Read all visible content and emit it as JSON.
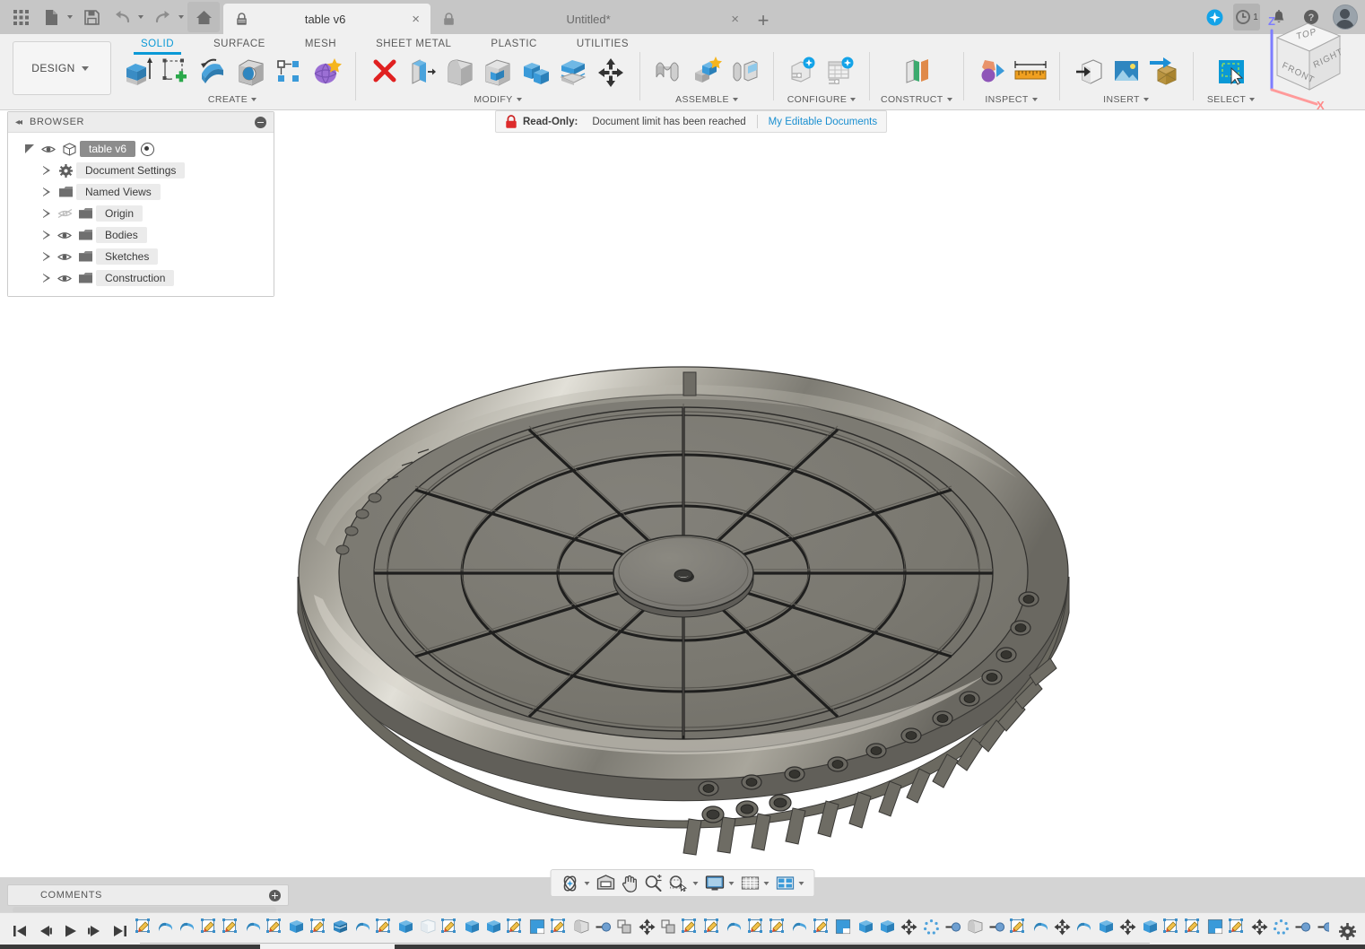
{
  "app": {
    "name": "Autodesk Fusion 360",
    "accent": "#0a99d6",
    "titlebar_bg": "#c6c6c6",
    "ribbon_bg": "#f0f0f0"
  },
  "quick_access": {
    "items": [
      {
        "name": "app-grid-icon",
        "label": "Show Data Panel"
      },
      {
        "name": "file-icon",
        "label": "File",
        "has_caret": true
      },
      {
        "name": "save-icon",
        "label": "Save"
      },
      {
        "name": "undo-icon",
        "label": "Undo",
        "has_caret": true
      },
      {
        "name": "redo-icon",
        "label": "Redo",
        "has_caret": true
      },
      {
        "name": "home-icon",
        "label": "Home"
      }
    ]
  },
  "tabs": [
    {
      "label": "table v6",
      "active": true,
      "locked": true,
      "close": "×"
    },
    {
      "label": "Untitled*",
      "active": false,
      "locked": true,
      "close": "×"
    }
  ],
  "tab_actions": {
    "new_tab": "+",
    "icons": [
      {
        "name": "fusion-sync-icon",
        "label": "Job Status"
      },
      {
        "name": "job-history-icon",
        "label": "1",
        "badge": "1",
        "highlighted": true
      },
      {
        "name": "notification-bell-icon",
        "label": "Notifications"
      },
      {
        "name": "help-icon",
        "label": "Help"
      },
      {
        "name": "account-avatar",
        "label": "Account"
      }
    ]
  },
  "workspace_selector": {
    "label": "DESIGN",
    "caret": "▾"
  },
  "ribbon_tabs": [
    {
      "label": "SOLID",
      "active": true
    },
    {
      "label": "SURFACE",
      "active": false
    },
    {
      "label": "MESH",
      "active": false
    },
    {
      "label": "SHEET METAL",
      "active": false
    },
    {
      "label": "PLASTIC",
      "active": false
    },
    {
      "label": "UTILITIES",
      "active": false
    }
  ],
  "ribbon_panels": [
    {
      "label": "CREATE",
      "has_caret": true,
      "tools": [
        {
          "name": "extrude-icon",
          "label": "Extrude"
        },
        {
          "name": "create-sketch-icon",
          "label": "Create Sketch"
        },
        {
          "name": "revolve-icon",
          "label": "Revolve"
        },
        {
          "name": "hole-icon",
          "label": "Hole"
        },
        {
          "name": "rectangular-pattern-icon",
          "label": "Rectangular Pattern"
        },
        {
          "name": "create-form-icon",
          "label": "Create Form"
        }
      ]
    },
    {
      "label": "MODIFY",
      "has_caret": true,
      "tools": [
        {
          "name": "delete-icon",
          "label": "Delete"
        },
        {
          "name": "press-pull-icon",
          "label": "Press Pull"
        },
        {
          "name": "fillet-icon",
          "label": "Fillet"
        },
        {
          "name": "shell-icon",
          "label": "Shell"
        },
        {
          "name": "combine-icon",
          "label": "Combine"
        },
        {
          "name": "split-face-icon",
          "label": "Split Face"
        },
        {
          "name": "move-copy-icon",
          "label": "Move/Copy"
        }
      ]
    },
    {
      "label": "ASSEMBLE",
      "has_caret": true,
      "tools": [
        {
          "name": "joint-icon",
          "label": "Joint"
        },
        {
          "name": "new-component-icon",
          "label": "New Component"
        },
        {
          "name": "as-built-joint-icon",
          "label": "As-built Joint"
        }
      ]
    },
    {
      "label": "CONFIGURE",
      "has_caret": true,
      "tools": [
        {
          "name": "configure-design-icon",
          "label": "Configure Design"
        },
        {
          "name": "configuration-table-icon",
          "label": "Configuration Table"
        }
      ]
    },
    {
      "label": "CONSTRUCT",
      "has_caret": true,
      "tools": [
        {
          "name": "construct-plane-icon",
          "label": "Offset Plane"
        }
      ]
    },
    {
      "label": "INSPECT",
      "has_caret": true,
      "tools": [
        {
          "name": "interference-icon",
          "label": "Interference"
        },
        {
          "name": "measure-icon",
          "label": "Measure"
        }
      ]
    },
    {
      "label": "INSERT",
      "has_caret": true,
      "tools": [
        {
          "name": "insert-derive-icon",
          "label": "Insert Derive"
        },
        {
          "name": "canvas-image-icon",
          "label": "Canvas"
        },
        {
          "name": "insert-mcmaster-icon",
          "label": "Insert McMaster-Carr Component"
        }
      ]
    },
    {
      "label": "SELECT",
      "has_caret": true,
      "tools": [
        {
          "name": "select-icon",
          "label": "Select"
        }
      ]
    }
  ],
  "browser": {
    "title": "BROWSER",
    "collapse_icon": "◀◀",
    "minimize_icon": "⊖",
    "tree": [
      {
        "label": "table v6",
        "level": 0,
        "expanded": true,
        "visible": true,
        "selected": true,
        "icon": "component-icon",
        "has_radio": true
      },
      {
        "label": "Document Settings",
        "level": 1,
        "expanded": false,
        "visible": null,
        "icon": "gear-icon"
      },
      {
        "label": "Named Views",
        "level": 1,
        "expanded": false,
        "visible": null,
        "icon": "folder-icon"
      },
      {
        "label": "Origin",
        "level": 1,
        "expanded": false,
        "visible": false,
        "icon": "folder-icon"
      },
      {
        "label": "Bodies",
        "level": 1,
        "expanded": false,
        "visible": true,
        "icon": "folder-icon"
      },
      {
        "label": "Sketches",
        "level": 1,
        "expanded": false,
        "visible": true,
        "icon": "folder-icon"
      },
      {
        "label": "Construction",
        "level": 1,
        "expanded": false,
        "visible": true,
        "icon": "folder-icon"
      }
    ]
  },
  "notification": {
    "lock_icon": "lock-red-icon",
    "status_label": "Read-Only:",
    "message": "Document limit has been reached",
    "link": "My Editable Documents",
    "link_color": "#1a8fd0"
  },
  "viewcube": {
    "faces": {
      "top": "TOP",
      "front": "FRONT",
      "right": "RIGHT"
    },
    "axes": {
      "z": "Z",
      "x": "X"
    },
    "z_color": "#6a6aff",
    "x_color": "#ff8080"
  },
  "navbar": {
    "items": [
      {
        "name": "orbit-icon",
        "label": "Orbit",
        "caret": true
      },
      {
        "name": "fit-icon",
        "label": "Fit",
        "caret": false
      },
      {
        "name": "pan-icon",
        "label": "Pan",
        "caret": false
      },
      {
        "name": "zoom-icon",
        "label": "Zoom",
        "caret": false
      },
      {
        "name": "zoom-window-icon",
        "label": "Zoom Window",
        "caret": true
      },
      {
        "name": "display-settings-icon",
        "label": "Display Settings",
        "caret": true
      },
      {
        "name": "grid-snaps-icon",
        "label": "Grid and Snaps",
        "caret": true
      },
      {
        "name": "viewports-icon",
        "label": "Viewports",
        "caret": true
      }
    ]
  },
  "comments": {
    "title": "COMMENTS",
    "add_icon": "⊕"
  },
  "timeline": {
    "playback": [
      {
        "name": "timeline-begin-button",
        "label": "Go to beginning"
      },
      {
        "name": "timeline-step-back-button",
        "label": "Step back"
      },
      {
        "name": "timeline-play-button",
        "label": "Play"
      },
      {
        "name": "timeline-step-forward-button",
        "label": "Step forward"
      },
      {
        "name": "timeline-end-button",
        "label": "Go to end"
      }
    ],
    "settings_icon": "timeline-settings-gear-icon",
    "features": [
      "sketch",
      "revolve",
      "revolve",
      "sketch",
      "sketch",
      "revolve",
      "sketch",
      "extrude",
      "sketch",
      "shell",
      "revolve",
      "sketch",
      "extrude",
      "shell-body",
      "sketch",
      "extrude",
      "extrude",
      "sketch",
      "split",
      "sketch",
      "fillet",
      "hole",
      "combine",
      "move",
      "combine",
      "sketch",
      "sketch",
      "revolve",
      "sketch",
      "sketch",
      "revolve",
      "sketch",
      "split",
      "extrude",
      "extrude",
      "move",
      "pattern",
      "hole",
      "fillet",
      "hole",
      "sketch",
      "revolve",
      "move",
      "revolve",
      "extrude",
      "move",
      "extrude",
      "sketch",
      "sketch",
      "split",
      "sketch",
      "move",
      "pattern",
      "hole",
      "hole",
      "move"
    ]
  },
  "model": {
    "name": "rotary-table-assembly",
    "description": "Grey shaded circular rotary table with 12 radial spokes, central hub boss, outer toroidal rim with counterbored bolt holes and underside radial ribs",
    "body_color": "#7a7870",
    "rim_highlight": "#cdcac0",
    "shadow_color": "#4e4c48",
    "edge_color": "#2b2b29",
    "background": "#ffffff",
    "spoke_count": 12,
    "bolt_hole_count": 24
  }
}
